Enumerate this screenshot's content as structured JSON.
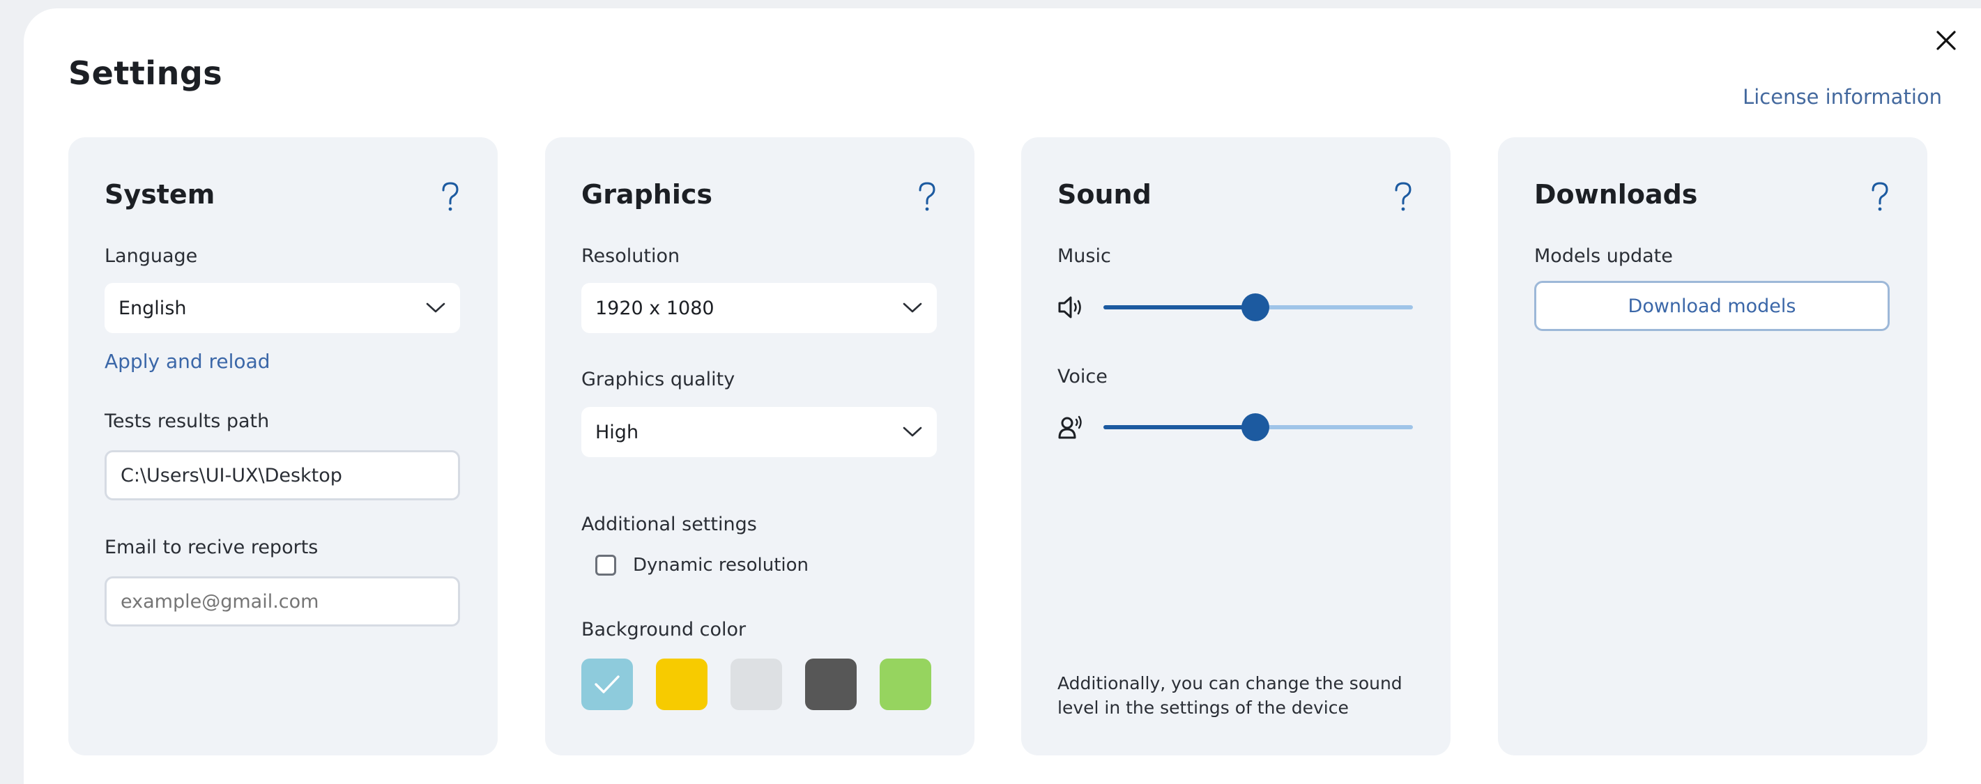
{
  "header": {
    "title": "Settings",
    "license_link": "License information"
  },
  "system": {
    "title": "System",
    "language_label": "Language",
    "language_value": "English",
    "apply_link": "Apply and reload",
    "tests_path_label": "Tests results path",
    "tests_path_value": "C:\\Users\\UI-UX\\Desktop",
    "email_label": "Email to recive reports",
    "email_placeholder": "example@gmail.com"
  },
  "graphics": {
    "title": "Graphics",
    "resolution_label": "Resolution",
    "resolution_value": "1920 x 1080",
    "quality_label": "Graphics quality",
    "quality_value": "High",
    "additional_label": "Additional settings",
    "dynamic_resolution_label": "Dynamic resolution",
    "dynamic_resolution_checked": false,
    "bg_color_label": "Background color",
    "colors": [
      "#8ecbdc",
      "#f7cb00",
      "#dde0e3",
      "#575757",
      "#96d45f"
    ],
    "selected_color_index": 0
  },
  "sound": {
    "title": "Sound",
    "music_label": "Music",
    "music_level": 0.49,
    "voice_label": "Voice",
    "voice_level": 0.49,
    "note": "Additionally, you can change the sound level in the settings of the device"
  },
  "downloads": {
    "title": "Downloads",
    "models_label": "Models update",
    "download_button": "Download models"
  },
  "icons": {
    "close": "close-icon",
    "help": "help-icon",
    "chevron": "chevron-down-icon",
    "speaker": "speaker-icon",
    "voice": "voice-icon",
    "check": "check-icon"
  }
}
